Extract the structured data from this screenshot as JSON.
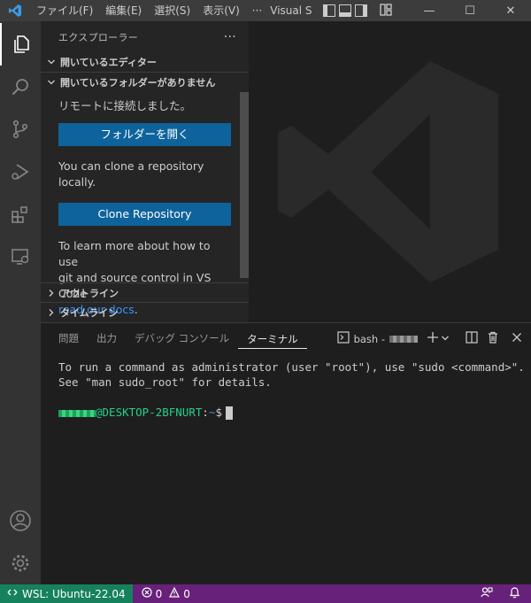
{
  "titlebar": {
    "menu": [
      "ファイル(F)",
      "編集(E)",
      "選択(S)",
      "表示(V)",
      "···"
    ],
    "title": "Visual S",
    "window_buttons": [
      "—",
      "☐",
      "✕"
    ]
  },
  "sidebar": {
    "title": "エクスプローラー",
    "more": "···",
    "section_open_editors": "開いているエディター",
    "section_no_folder": "開いているフォルダーがありません",
    "remote_connected": "リモートに接続しました。",
    "open_folder_button": "フォルダーを開く",
    "clone_text": "You can clone a repository locally.",
    "clone_button": "Clone Repository",
    "learn_more_1": "To learn more about how to use",
    "learn_more_2": "git and source control in VS Code",
    "read_docs_link": "read our docs",
    "period": ".",
    "section_outline": "アウトライン",
    "section_timeline": "タイムライン"
  },
  "panel": {
    "tabs": [
      "問題",
      "出力",
      "デバッグ コンソール",
      "ターミナル"
    ],
    "active_tab": "ターミナル",
    "terminal_name": "bash -"
  },
  "terminal": {
    "line1": "To run a command as administrator (user \"root\"), use \"sudo <command>\".",
    "line2": "See \"man sudo_root\" for details.",
    "host": "@DESKTOP-2BFNURT",
    "colon": ":",
    "path": "~",
    "prompt": "$"
  },
  "statusbar": {
    "remote": "WSL: Ubuntu-22.04",
    "errors": "0",
    "warnings": "0"
  },
  "colors": {
    "accent": "#0e639c",
    "status": "#68217a",
    "remote": "#16825d",
    "link": "#3794ff"
  }
}
